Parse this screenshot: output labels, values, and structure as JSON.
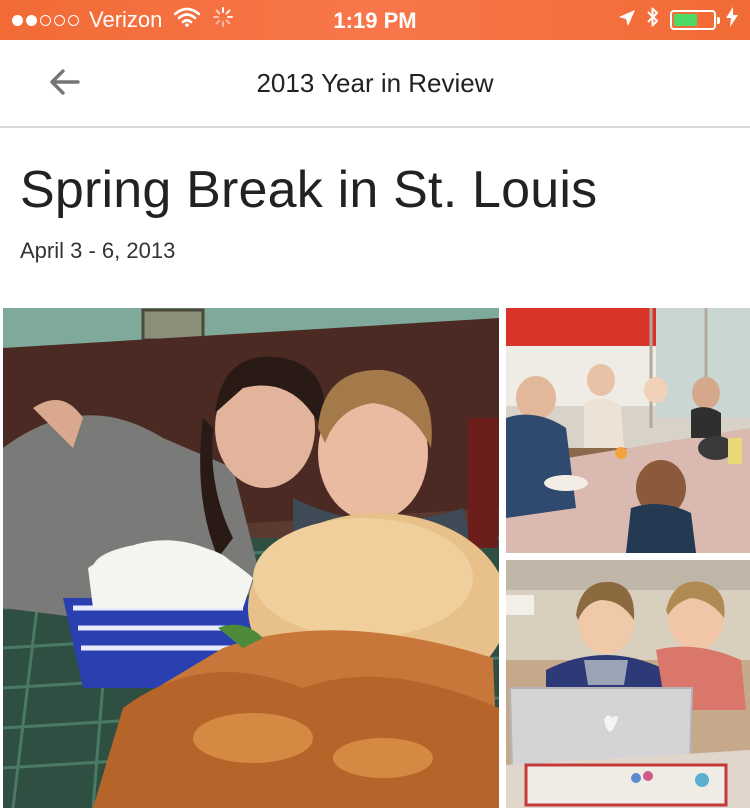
{
  "status_bar": {
    "carrier": "Verizon",
    "time": "1:19 PM",
    "signal_bars_filled": 2,
    "signal_bars_total": 5,
    "battery_level": 0.6,
    "icons": [
      "wifi-icon",
      "loading-icon",
      "location-arrow-icon",
      "bluetooth-icon",
      "battery-icon",
      "charging-bolt-icon"
    ],
    "colors": {
      "background": "#f26b36",
      "battery_fill": "#4cd964"
    }
  },
  "app_bar": {
    "title": "2013 Year in Review",
    "back_icon": "arrow-left-icon"
  },
  "event": {
    "title": "Spring Break in St. Louis",
    "date_range": "April 3 - 6, 2013"
  },
  "photos": [
    {
      "subject": "mother-and-son-booth-with-fried-chicken-sandwich"
    },
    {
      "subject": "family-breakfast-table"
    },
    {
      "subject": "two-boys-with-laptop"
    }
  ]
}
